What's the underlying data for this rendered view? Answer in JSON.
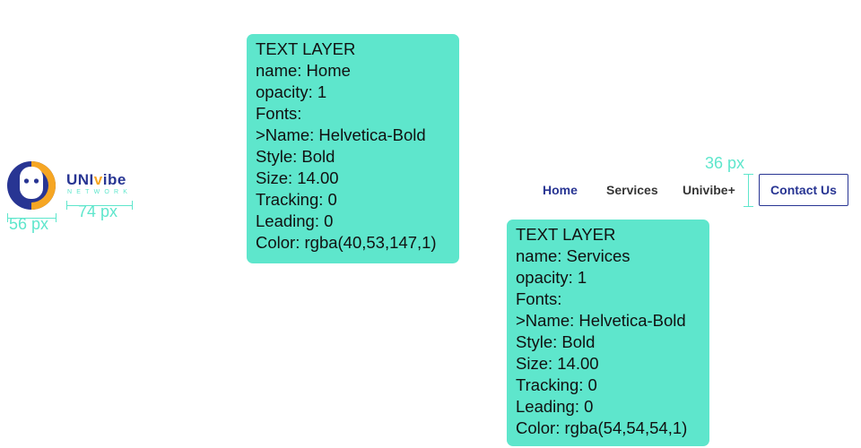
{
  "logo": {
    "brand_main_uni": "UNI",
    "brand_main_i": "v",
    "brand_main_rest": "ibe",
    "brand_sub": "NETWORK",
    "colors": {
      "navy": "#283593",
      "orange": "#f6a623"
    }
  },
  "measurements": {
    "logo_mark_width": "56 px",
    "wordmark_width": "74 px",
    "nav_height": "36 px",
    "annotation_color": "#5ee6cc"
  },
  "spec_panels": [
    {
      "lines": [
        "TEXT LAYER",
        "name: Home",
        "opacity: 1",
        "Fonts:",
        ">Name: Helvetica-Bold",
        "Style: Bold",
        "Size: 14.00",
        "Tracking: 0",
        "Leading: 0",
        "Color: rgba(40,53,147,1)"
      ]
    },
    {
      "lines": [
        "TEXT LAYER",
        "name: Services",
        "opacity: 1",
        "Fonts:",
        ">Name: Helvetica-Bold",
        "Style: Bold",
        "Size: 14.00",
        "Tracking: 0",
        "Leading: 0",
        "Color: rgba(54,54,54,1)"
      ]
    }
  ],
  "nav": {
    "home": "Home",
    "services": "Services",
    "univibe": "Univibe+",
    "contact": "Contact Us",
    "colors": {
      "active": "#283593",
      "default": "#363636"
    }
  }
}
